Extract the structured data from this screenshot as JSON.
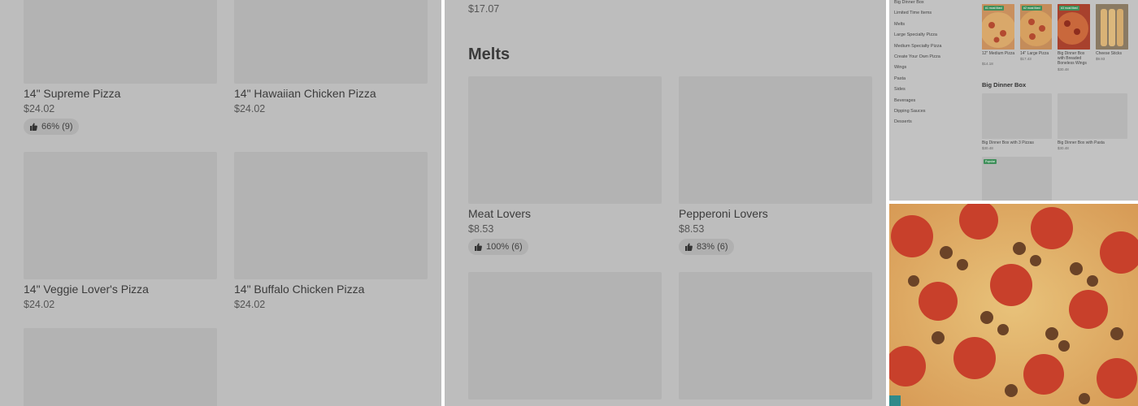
{
  "left_panel": {
    "items": [
      {
        "name": "14\" Supreme Pizza",
        "price": "$24.02",
        "rating": "66% (9)"
      },
      {
        "name": "14\" Hawaiian Chicken Pizza",
        "price": "$24.02"
      },
      {
        "name": "14\" Veggie Lover's Pizza",
        "price": "$24.02"
      },
      {
        "name": "14\" Buffalo Chicken Pizza",
        "price": "$24.02"
      }
    ]
  },
  "middle_panel": {
    "top_price": "$17.07",
    "section_title": "Melts",
    "items": [
      {
        "name": "Meat Lovers",
        "price": "$8.53",
        "rating": "100% (6)"
      },
      {
        "name": "Pepperoni Lovers",
        "price": "$8.53",
        "rating": "83% (6)"
      }
    ]
  },
  "mini_page": {
    "sidebar": [
      "Big Dinner Box",
      "Limited Time Items",
      "Melts",
      "Large Specialty Pizza",
      "Medium Specialty Pizza",
      "Create Your Own Pizza",
      "Wings",
      "Pasta",
      "Sides",
      "Beverages",
      "Dipping Sauces",
      "Desserts"
    ],
    "featured": [
      {
        "tag": "#1 most liked",
        "label": "12\" Medium Pizza",
        "price": "$14.18"
      },
      {
        "tag": "#2 most liked",
        "label": "14\" Large Pizza",
        "price": "$17.43"
      },
      {
        "tag": "#3 most liked",
        "label": "Big Dinner Box with Breaded Boneless Wings",
        "price": "$30.48"
      },
      {
        "label": "Cheese Sticks",
        "price": "$9.93"
      }
    ],
    "section_title": "Big Dinner Box",
    "box_items": [
      {
        "label": "Big Dinner Box with 3 Pizzas",
        "price": "$30.48"
      },
      {
        "label": "Big Dinner Box with Pasta",
        "price": "$30.48"
      }
    ],
    "popular_tag": "Popular"
  },
  "colors": {
    "overlay_gray": "#bdbdbd",
    "placeholder": "#b3b3b3",
    "pepperoni_red": "#c8452f",
    "tag_green": "#3f8f5a"
  }
}
